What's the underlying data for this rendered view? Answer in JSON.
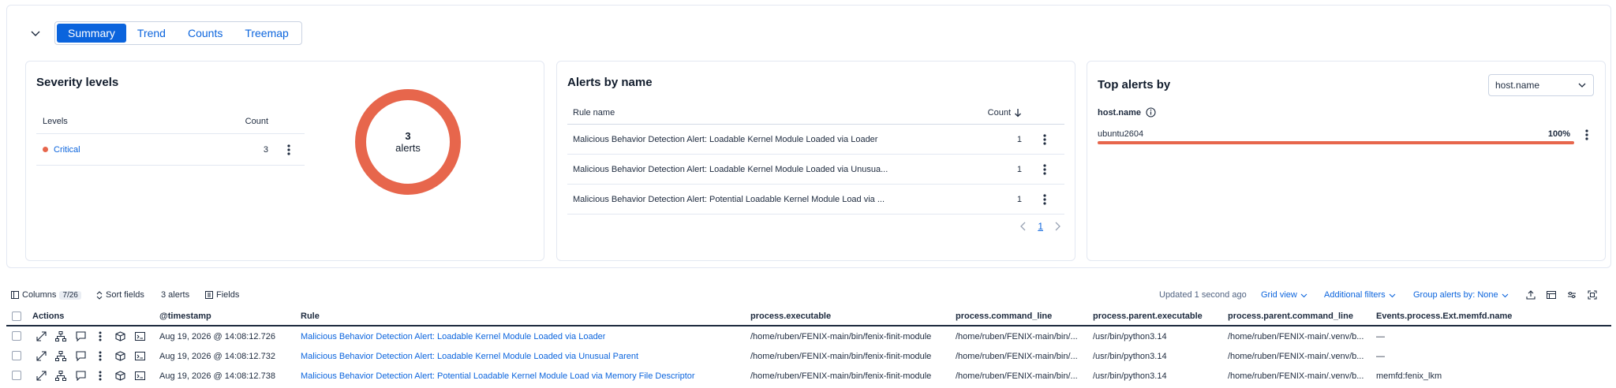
{
  "tabs": [
    "Summary",
    "Trend",
    "Counts",
    "Treemap"
  ],
  "severity": {
    "title": "Severity levels",
    "col_levels": "Levels",
    "col_count": "Count",
    "rows": [
      {
        "level": "Critical",
        "count": "3"
      }
    ],
    "donut_count": "3",
    "donut_label": "alerts",
    "color": "#e7664c"
  },
  "alerts_by_name": {
    "title": "Alerts by name",
    "col_rule": "Rule name",
    "col_count": "Count",
    "rows": [
      {
        "rule": "Malicious Behavior Detection Alert: Loadable Kernel Module Loaded via Loader",
        "count": "1"
      },
      {
        "rule": "Malicious Behavior Detection Alert: Loadable Kernel Module Loaded via Unusua...",
        "count": "1"
      },
      {
        "rule": "Malicious Behavior Detection Alert: Potential Loadable Kernel Module Load via ...",
        "count": "1"
      }
    ],
    "page": "1"
  },
  "top_alerts": {
    "title": "Top alerts by",
    "select_value": "host.name",
    "field": "host.name",
    "rows": [
      {
        "value": "ubuntu2604",
        "pct": "100%",
        "fraction": 1.0
      }
    ]
  },
  "toolbar": {
    "columns": "Columns",
    "columns_badge": "7/26",
    "sort": "Sort fields",
    "alerts_count": "3 alerts",
    "fields": "Fields",
    "updated": "Updated 1 second ago",
    "grid_view": "Grid view",
    "additional_filters": "Additional filters",
    "group_alerts": "Group alerts by: None"
  },
  "grid": {
    "headers": {
      "actions": "Actions",
      "timestamp": "@timestamp",
      "rule": "Rule",
      "exe": "process.executable",
      "cmd": "process.command_line",
      "pexe": "process.parent.executable",
      "pcmd": "process.parent.command_line",
      "memfd": "Events.process.Ext.memfd.name"
    },
    "rows": [
      {
        "timestamp": "Aug 19, 2026 @ 14:08:12.726",
        "rule": "Malicious Behavior Detection Alert: Loadable Kernel Module Loaded via Loader",
        "exe": "/home/ruben/FENIX-main/bin/fenix-finit-module",
        "cmd": "/home/ruben/FENIX-main/bin/...",
        "pexe": "/usr/bin/python3.14",
        "pcmd": "/home/ruben/FENIX-main/.venv/b...",
        "memfd": "—"
      },
      {
        "timestamp": "Aug 19, 2026 @ 14:08:12.732",
        "rule": "Malicious Behavior Detection Alert: Loadable Kernel Module Loaded via Unusual Parent",
        "exe": "/home/ruben/FENIX-main/bin/fenix-finit-module",
        "cmd": "/home/ruben/FENIX-main/bin/...",
        "pexe": "/usr/bin/python3.14",
        "pcmd": "/home/ruben/FENIX-main/.venv/b...",
        "memfd": "—"
      },
      {
        "timestamp": "Aug 19, 2026 @ 14:08:12.738",
        "rule": "Malicious Behavior Detection Alert: Potential Loadable Kernel Module Load via Memory File Descriptor",
        "exe": "/home/ruben/FENIX-main/bin/fenix-finit-module",
        "cmd": "/home/ruben/FENIX-main/bin/...",
        "pexe": "/usr/bin/python3.14",
        "pcmd": "/home/ruben/FENIX-main/.venv/b...",
        "memfd": "memfd:fenix_lkm"
      }
    ]
  }
}
